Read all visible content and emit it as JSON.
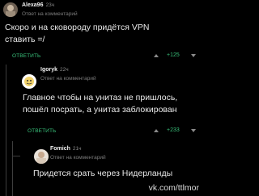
{
  "comments": [
    {
      "author": "Alexa96",
      "time": "23ч",
      "reply_note": "Ответ на комментарий",
      "text_lines": [
        "Скоро и на сковороду придётся VPN",
        "ставить =/"
      ],
      "reply_label": "ОТВЕТИТЬ",
      "votes": "+125",
      "avatar_color": "#9c8c7a"
    },
    {
      "author": "Igoryk",
      "time": "22ч",
      "reply_note": "Ответ на комментарий",
      "text_lines": [
        "Главное чтобы на унитаз не пришлось,",
        "пошёл посрать, а унитаз заблокирован"
      ],
      "reply_label": "ОТВЕТИТЬ",
      "votes": "+233",
      "avatar_color": "#f2d36b"
    },
    {
      "author": "Fomich",
      "time": "21ч",
      "reply_note": "Ответ на комментарий",
      "text_lines": [
        "Придется срать через Нидерланды"
      ],
      "avatar_color": "#d8c9b8"
    }
  ],
  "watermark": "vk.com/ttlmor",
  "colors": {
    "accent": "#39c07a",
    "background": "#000000"
  }
}
